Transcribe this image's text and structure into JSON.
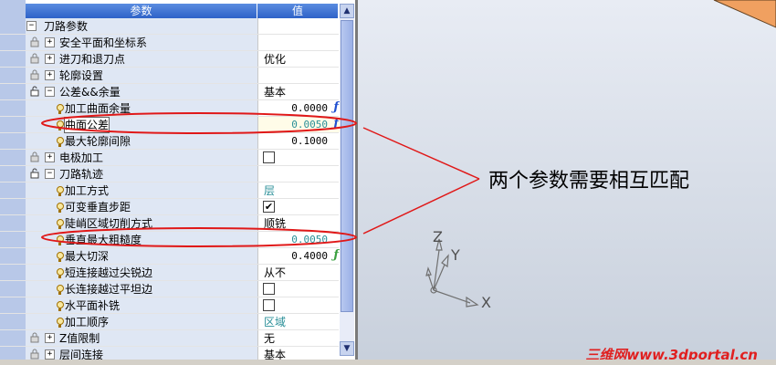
{
  "header": {
    "col_param": "参数",
    "col_value": "值"
  },
  "rows": [
    {
      "label": "刀路参数",
      "value": "",
      "toggle": "−"
    },
    {
      "label": "安全平面和坐标系",
      "value": "",
      "toggle": "+"
    },
    {
      "label": "进刀和退刀点",
      "value": "优化",
      "toggle": "+"
    },
    {
      "label": "轮廓设置",
      "value": ""
    },
    {
      "label": "公差&&余量",
      "value": "基本",
      "toggle": "−"
    },
    {
      "label": "加工曲面余量",
      "value": "0.0000",
      "fx": "ƒ"
    },
    {
      "label": "曲面公差",
      "value": "0.0050",
      "fx": "ƒ"
    },
    {
      "label": "最大轮廓间隙",
      "value": "0.1000"
    },
    {
      "label": "电极加工",
      "value": "",
      "toggle": "+"
    },
    {
      "label": "刀路轨迹",
      "value": "",
      "toggle": "−"
    },
    {
      "label": "加工方式",
      "value": "层"
    },
    {
      "label": "可变垂直步距",
      "value": "✔"
    },
    {
      "label": "陡峭区域切削方式",
      "value": "顺铣"
    },
    {
      "label": "垂直最大粗糙度",
      "value": "0.0050"
    },
    {
      "label": "最大切深",
      "value": "0.4000",
      "fx": "ƒ"
    },
    {
      "label": "短连接越过尖锐边",
      "value": "从不"
    },
    {
      "label": "长连接越过平坦边",
      "value": ""
    },
    {
      "label": "水平面补铣",
      "value": ""
    },
    {
      "label": "加工顺序",
      "value": "区域"
    },
    {
      "label": "Z值限制",
      "value": "无",
      "toggle": "+"
    },
    {
      "label": "层间连接",
      "value": "基本",
      "toggle": "+"
    }
  ],
  "scroll": {
    "up": "▲",
    "down": "▼"
  },
  "annotation": {
    "text": "两个参数需要相互匹配"
  },
  "axes": {
    "z": "Z",
    "y": "Y",
    "x": "X"
  },
  "watermark": "三维网www.3dportal.cn",
  "colors": {
    "highlight_ellipse": "#e01818",
    "header_blue": "#3a6fd8",
    "teal_value": "#2a8f98"
  }
}
